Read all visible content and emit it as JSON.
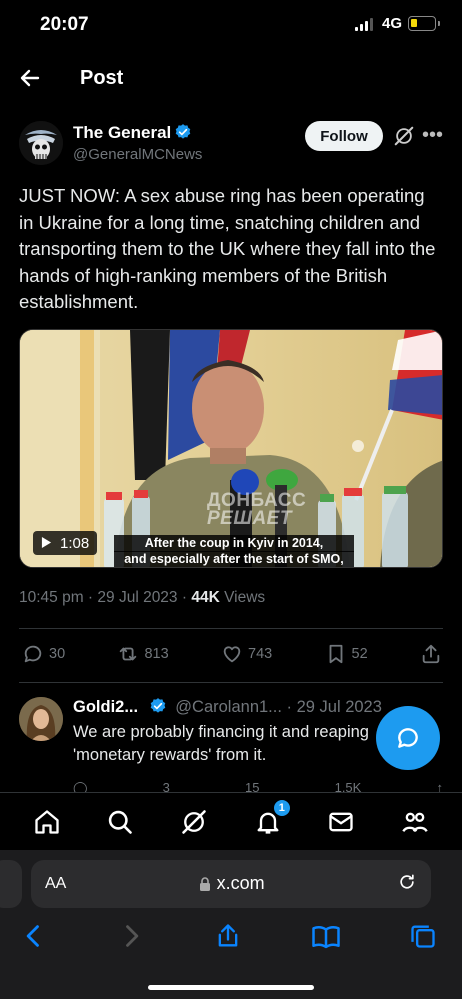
{
  "status_bar": {
    "time": "20:07",
    "network": "4G"
  },
  "header": {
    "title": "Post"
  },
  "tweet": {
    "author_name": "The General",
    "author_handle": "@GeneralMCNews",
    "follow_label": "Follow",
    "text": "JUST NOW: A sex abuse ring has been operating in Ukraine for a long time, snatching children and transporting them to the UK where they fall into the hands of high-ranking members of the British establishment.",
    "video": {
      "duration": "1:08",
      "watermark_line1": "ДОНБАСС",
      "watermark_line2": "РЕШАЕТ",
      "subtitle_line1": "After the coup in Kyiv in 2014,",
      "subtitle_line2": "and especially after the start of SMO,"
    },
    "timestamp": "10:45 pm · 29 Jul 2023 · ",
    "views_count": "44K",
    "views_label": " Views",
    "stats": {
      "replies": "30",
      "reposts": "813",
      "likes": "743",
      "bookmarks": "52"
    }
  },
  "reply": {
    "name": "Goldi2...",
    "handle": "@Carolann1...",
    "date": "· 29 Jul 2023",
    "text": "We are probably financing it and reaping 'monetary rewards' from it.",
    "stats": {
      "reposts": "3",
      "likes": "15",
      "views": "1.5K"
    }
  },
  "bottom_nav": {
    "notifications_badge": "1"
  },
  "browser": {
    "aa_label": "AA",
    "url": "x.com"
  },
  "colors": {
    "accent": "#1d9bf0",
    "background": "#000000",
    "muted": "#71767b"
  }
}
